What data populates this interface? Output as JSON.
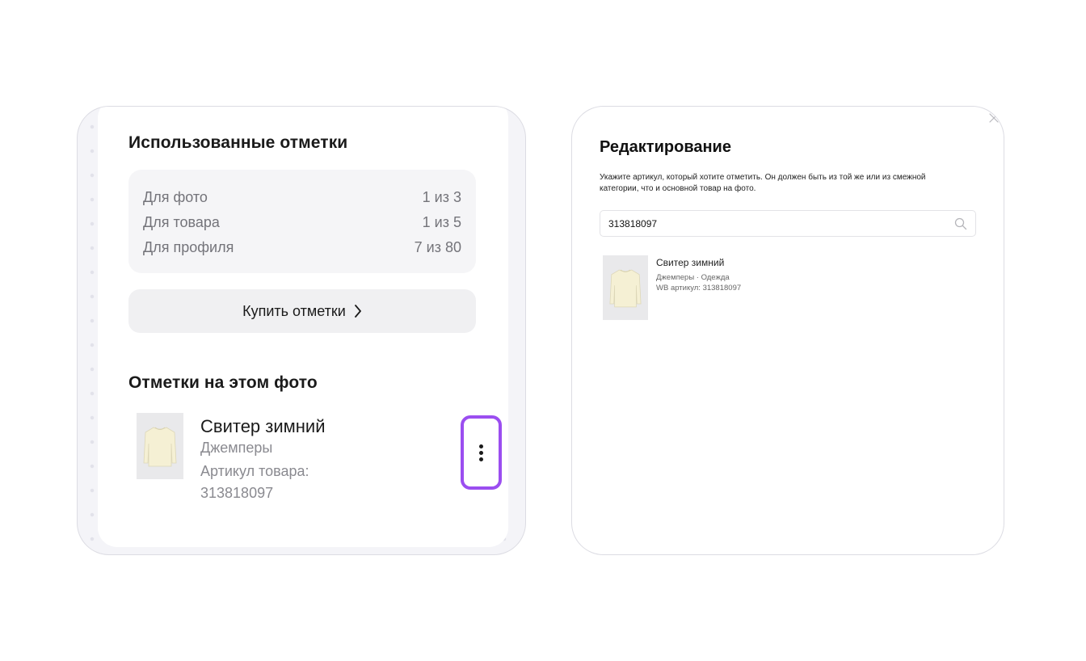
{
  "used_marks": {
    "title": "Использованные отметки",
    "stats": [
      {
        "label": "Для фото",
        "value": "1 из 3"
      },
      {
        "label": "Для товара",
        "value": "1 из 5"
      },
      {
        "label": "Для профиля",
        "value": "7 из 80"
      }
    ],
    "buy_label": "Купить отметки"
  },
  "photo_marks": {
    "title": "Отметки на этом фото",
    "item": {
      "name": "Свитер зимний",
      "category": "Джемперы",
      "article": "Артикул товара: 313818097"
    }
  },
  "edit_modal": {
    "title": "Редактирование",
    "description": "Укажите артикул, который хотите отметить. Он должен быть из той же или из смежной категории, что и основной товар на фото.",
    "search_value": "313818097",
    "result": {
      "name": "Свитер зимний",
      "category": "Джемперы · Одежда",
      "article": "WB артикул: 313818097"
    }
  },
  "colors": {
    "accent": "#9b4ef0",
    "panel_border": "#dcdce3",
    "muted_text": "#74747a"
  },
  "icons": [
    "chevron-right-icon",
    "more-vertical-icon",
    "search-icon",
    "close-icon"
  ]
}
